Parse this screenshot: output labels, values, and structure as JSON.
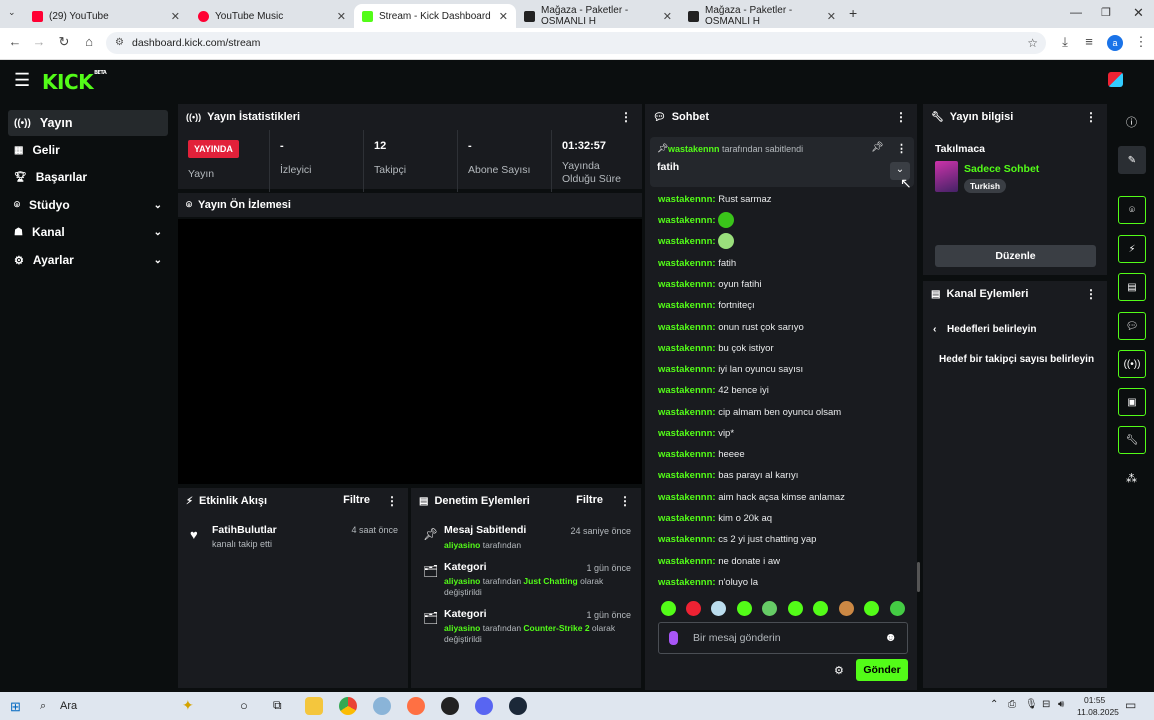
{
  "browser": {
    "tabs": [
      {
        "label": "(29) YouTube",
        "color": "#ff0033"
      },
      {
        "label": "YouTube Music",
        "color": "#ff0033"
      },
      {
        "label": "Stream - Kick Dashboard",
        "color": "#53fc18"
      },
      {
        "label": "Mağaza - Paketler - OSMANLI H",
        "color": "#222222"
      },
      {
        "label": "Mağaza - Paketler - OSMANLI H",
        "color": "#222222"
      }
    ],
    "url": "dashboard.kick.com/stream",
    "profile_initial": "a"
  },
  "app": {
    "logo": "KICK",
    "logo_badge": "BETA",
    "accent": "#53fc18"
  },
  "sidebar": {
    "items": [
      {
        "label": "Yayın",
        "icon": "broadcast-icon"
      },
      {
        "label": "Gelir",
        "icon": "revenue-icon"
      },
      {
        "label": "Başarılar",
        "icon": "trophy-icon"
      },
      {
        "label": "Stüdyo",
        "icon": "studio-icon"
      },
      {
        "label": "Kanal",
        "icon": "channel-icon"
      },
      {
        "label": "Ayarlar",
        "icon": "gear-icon"
      }
    ]
  },
  "stats": {
    "title": "Yayın İstatistikleri",
    "live_badge": "YAYINDA",
    "live_label": "Yayın",
    "viewers_value": "-",
    "viewers_label": "İzleyici",
    "followers_value": "12",
    "followers_label": "Takipçi",
    "subs_value": "-",
    "subs_label": "Abone Sayısı",
    "uptime_value": "01:32:57",
    "uptime_label": "Yayında Olduğu Süre"
  },
  "preview": {
    "title": "Yayın Ön İzlemesi"
  },
  "activity": {
    "title": "Etkinlik Akışı",
    "filter": "Filtre",
    "items": [
      {
        "user": "FatihBulutlar",
        "action": "kanalı takip etti",
        "time": "4 saat önce"
      }
    ]
  },
  "moderation": {
    "title": "Denetim Eylemleri",
    "filter": "Filtre",
    "items": [
      {
        "title": "Mesaj Sabitlendi",
        "time": "24 saniye önce",
        "user": "aliyasino",
        "mid": "tarafından",
        "target": "",
        "tail": ""
      },
      {
        "title": "Kategori",
        "time": "1 gün önce",
        "user": "aliyasino",
        "mid": "tarafından",
        "target": "Just Chatting",
        "tail": "olarak değiştirildi"
      },
      {
        "title": "Kategori",
        "time": "1 gün önce",
        "user": "aliyasino",
        "mid": "tarafından",
        "target": "Counter-Strike 2",
        "tail": "olarak değiştirildi"
      }
    ]
  },
  "chat": {
    "title": "Sohbet",
    "pinned_user": "wastakennn",
    "pinned_by": "tarafından sabitlendi",
    "pinned_text": "fatih",
    "messages": [
      {
        "user": "wastakennn:",
        "text": "Rust sarmaz"
      },
      {
        "user": "wastakennn:",
        "text": ""
      },
      {
        "user": "wastakennn:",
        "text": ""
      },
      {
        "user": "wastakennn:",
        "text": "fatih"
      },
      {
        "user": "wastakennn:",
        "text": "oyun fatihi"
      },
      {
        "user": "wastakennn:",
        "text": "fortniteçı"
      },
      {
        "user": "wastakennn:",
        "text": "onun rust çok sarıyo"
      },
      {
        "user": "wastakennn:",
        "text": "bu çok istiyor"
      },
      {
        "user": "wastakennn:",
        "text": "iyi lan oyuncu sayısı"
      },
      {
        "user": "wastakennn:",
        "text": "42 bence iyi"
      },
      {
        "user": "wastakennn:",
        "text": "cip almam ben oyuncu olsam"
      },
      {
        "user": "wastakennn:",
        "text": "vip*"
      },
      {
        "user": "wastakennn:",
        "text": "heeee"
      },
      {
        "user": "wastakennn:",
        "text": "bas parayı al karıyı"
      },
      {
        "user": "wastakennn:",
        "text": "aim hack açsa kimse anlamaz"
      },
      {
        "user": "wastakennn:",
        "text": "kim o 20k aq"
      },
      {
        "user": "wastakennn:",
        "text": "cs 2 yi just chatting yap"
      },
      {
        "user": "wastakennn:",
        "text": "ne donate i aw"
      },
      {
        "user": "wastakennn:",
        "text": "n'oluyo la"
      }
    ],
    "input_placeholder": "Bir mesaj gönderin",
    "send": "Gönder"
  },
  "stream_info": {
    "title": "Yayın bilgisi",
    "stream_title": "Takılmaca",
    "category": "Sadece Sohbet",
    "language": "Turkish",
    "edit": "Düzenle"
  },
  "channel_actions": {
    "title": "Kanal Eylemleri",
    "back_label": "Hedefleri belirleyin",
    "goal_label": "Hedef bir takipçi sayısı belirleyin"
  },
  "taskbar": {
    "search": "Ara",
    "time": "01:55",
    "date": "11.08.2025"
  }
}
